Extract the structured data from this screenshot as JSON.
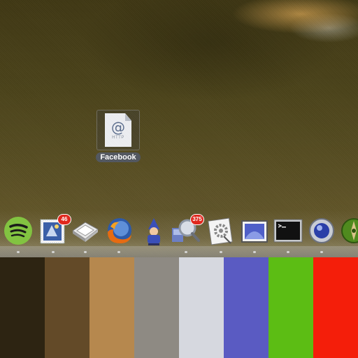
{
  "desktop": {
    "file": {
      "label": "Facebook",
      "glyph": "@",
      "kind": "HTTP",
      "icon": "webloc-file-icon"
    }
  },
  "dock": {
    "items": [
      {
        "name": "spotify",
        "icon": "spotify-icon",
        "running": true,
        "badge": ""
      },
      {
        "name": "mail",
        "icon": "mail-stamp-icon",
        "running": true,
        "badge": "46"
      },
      {
        "name": "preview",
        "icon": "preview-icon",
        "running": true,
        "badge": ""
      },
      {
        "name": "firefox",
        "icon": "firefox-icon",
        "running": true,
        "badge": ""
      },
      {
        "name": "wizard",
        "icon": "wizard-icon",
        "running": false,
        "badge": ""
      },
      {
        "name": "network",
        "icon": "network-magnifier-icon",
        "running": true,
        "badge": "375"
      },
      {
        "name": "system-preferences",
        "icon": "gear-document-icon",
        "running": true,
        "badge": ""
      },
      {
        "name": "photo-viewer",
        "icon": "photo-frame-icon",
        "running": true,
        "badge": ""
      },
      {
        "name": "terminal",
        "icon": "terminal-icon",
        "running": true,
        "badge": ""
      },
      {
        "name": "qsync",
        "icon": "blue-orb-icon",
        "running": true,
        "badge": ""
      },
      {
        "name": "green-app",
        "icon": "green-compass-icon",
        "running": false,
        "badge": ""
      }
    ]
  },
  "palette": [
    "#2d2412",
    "#634a28",
    "#b6884e",
    "#8e8a83",
    "#d6d8df",
    "#5a5bc2",
    "#5cbd14",
    "#f41e0a"
  ]
}
